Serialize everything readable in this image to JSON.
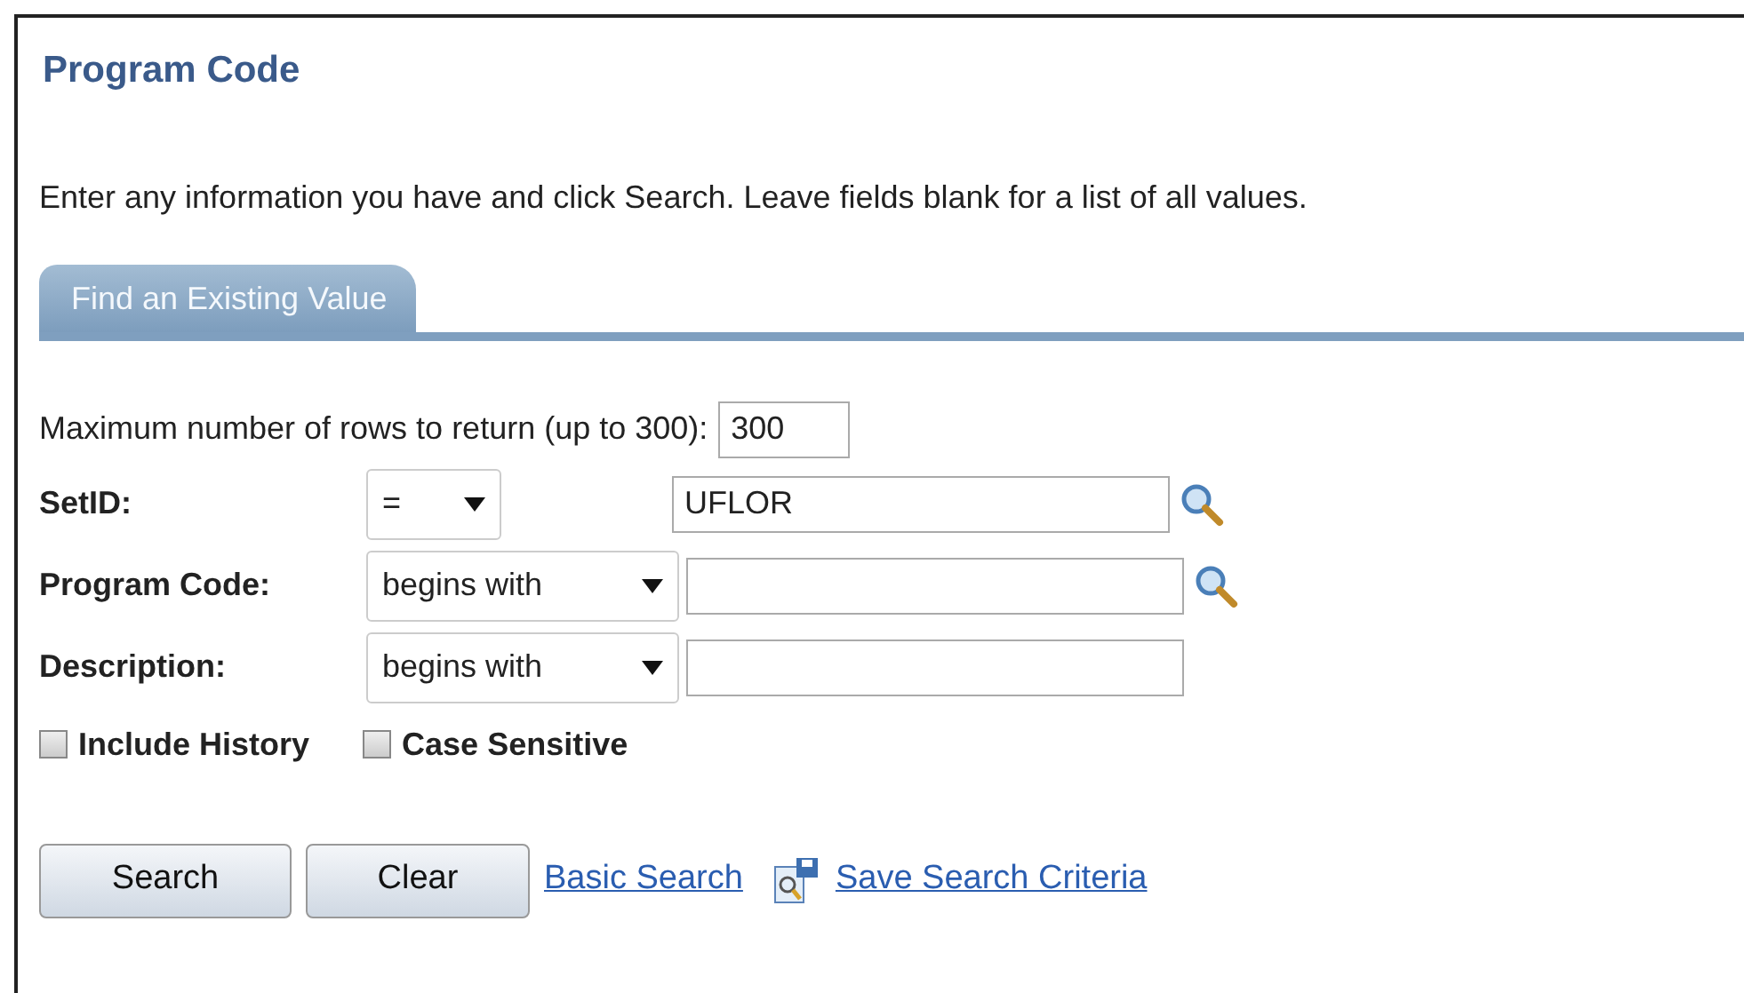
{
  "title": "Program Code",
  "instructions": "Enter any information you have and click Search. Leave fields blank for a list of all values.",
  "tabs": [
    {
      "label": "Find an Existing Value",
      "selected": true
    }
  ],
  "max_rows": {
    "label": "Maximum number of rows to return (up to 300):",
    "value": "300"
  },
  "criteria": [
    {
      "label": "SetID:",
      "operator": "=",
      "value": "UFLOR",
      "lookup": true
    },
    {
      "label": "Program Code:",
      "operator": "begins with",
      "lookup": true
    },
    {
      "label": "Description:",
      "operator": "begins with",
      "lookup": false
    }
  ],
  "checkboxes": [
    {
      "label": "Include History",
      "checked": false
    },
    {
      "label": "Case Sensitive",
      "checked": false
    }
  ],
  "buttons": [
    "Search",
    "Clear"
  ],
  "links": [
    {
      "label": "Basic Search",
      "icon": false
    },
    {
      "label": "Save Search Criteria",
      "icon": true
    }
  ]
}
